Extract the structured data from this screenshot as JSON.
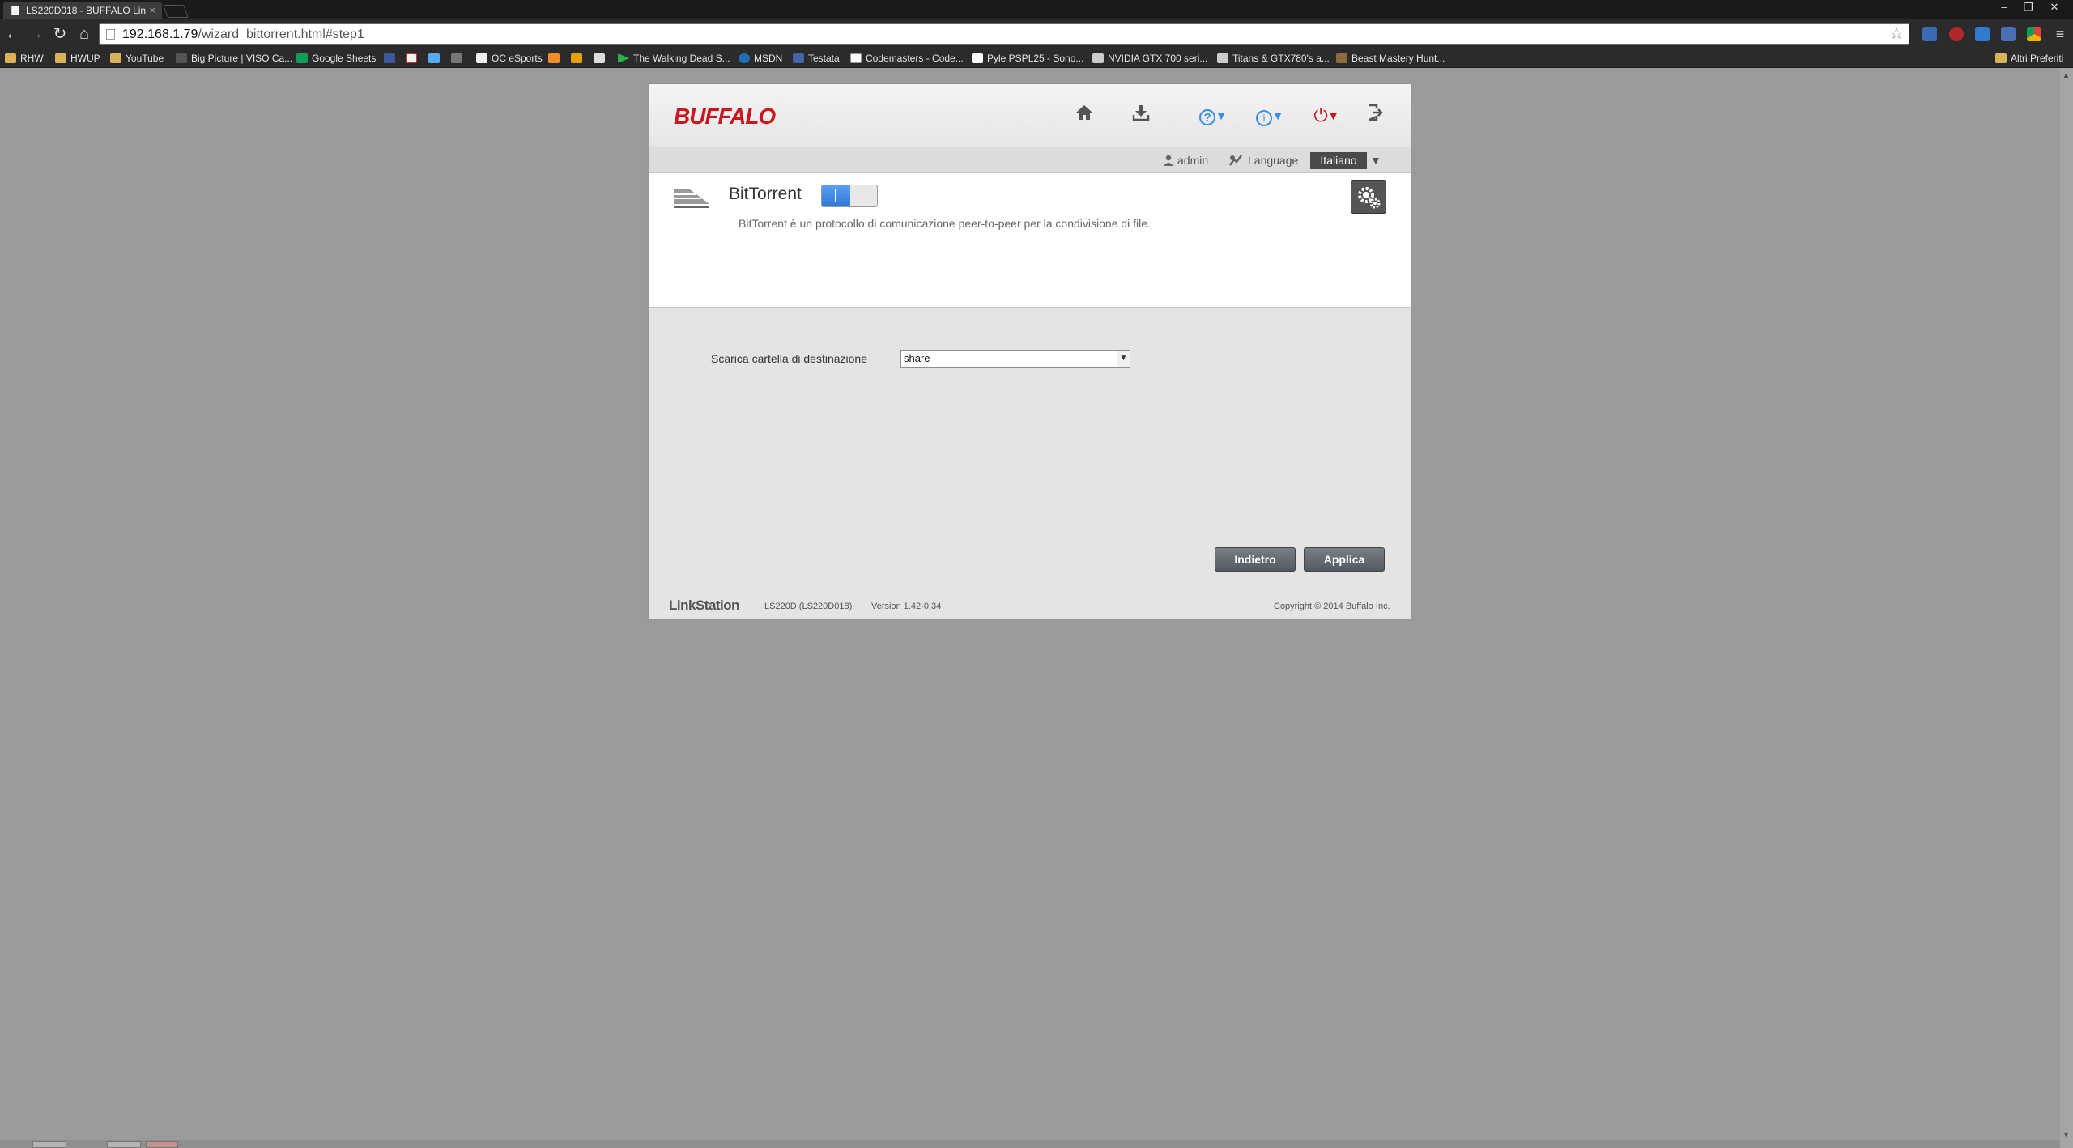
{
  "browser": {
    "tab_title": "LS220D018 - BUFFALO Lin",
    "tab_close": "×",
    "url_host": "192.168.1.79",
    "url_path": "/wizard_bittorrent.html#step1",
    "window_controls": [
      "–",
      "❐",
      "✕"
    ],
    "bookmarks": [
      {
        "label": "RHW",
        "icon": "folder-icon"
      },
      {
        "label": "HWUP",
        "icon": "folder-icon"
      },
      {
        "label": "YouTube",
        "icon": "folder-icon"
      },
      {
        "label": "Big Picture | VISO Ca...",
        "icon": "viso-icon"
      },
      {
        "label": "Google Sheets",
        "icon": "sheets-icon"
      },
      {
        "label": "",
        "icon": "facebook-icon"
      },
      {
        "label": "",
        "icon": "gmail-icon"
      },
      {
        "label": "",
        "icon": "twitter-icon"
      },
      {
        "label": "",
        "icon": "bird-icon"
      },
      {
        "label": "OC eSports",
        "icon": "page-icon"
      },
      {
        "label": "",
        "icon": "chart-icon"
      },
      {
        "label": "",
        "icon": "plex-icon"
      },
      {
        "label": "",
        "icon": "robot-icon"
      },
      {
        "label": "The Walking Dead S...",
        "icon": "play-icon"
      },
      {
        "label": "MSDN",
        "icon": "msdn-icon"
      },
      {
        "label": "Testata",
        "icon": "testata-icon"
      },
      {
        "label": "Codemasters - Code...",
        "icon": "codemasters-icon"
      },
      {
        "label": "Pyle PSPL25 - Sono...",
        "icon": "amazon-icon"
      },
      {
        "label": "NVIDIA GTX 700 seri...",
        "icon": "tech-icon"
      },
      {
        "label": "Titans & GTX780's a...",
        "icon": "tech-icon"
      },
      {
        "label": "Beast Mastery Hunt...",
        "icon": "wow-icon"
      }
    ],
    "other_bookmarks": "Altri Preferiti"
  },
  "header": {
    "logo": "BUFFALO",
    "help_icon": "?",
    "info_icon": "i",
    "power_icon": "⏻",
    "caret": "▼"
  },
  "userbar": {
    "user": "admin",
    "language_label": "Language",
    "language_value": "Italiano"
  },
  "panel": {
    "title": "BitTorrent",
    "description": "BitTorrent è un protocollo di comunicazione peer-to-peer per la condivisione di file.",
    "toggle_on": true
  },
  "form": {
    "label": "Scarica cartella di destinazione",
    "value": "share"
  },
  "buttons": {
    "back": "Indietro",
    "apply": "Applica"
  },
  "footer": {
    "brand": "LinkStation",
    "model": "LS220D (LS220D018)",
    "version": "Version 1.42-0.34",
    "copyright": "Copyright © 2014 Buffalo Inc."
  },
  "colors": {
    "brand_red": "#c8171e",
    "toggle_blue": "#2f78d8",
    "help_blue": "#3a8ee6",
    "power_red": "#c8171e",
    "page_background": "#9b9b9b"
  }
}
